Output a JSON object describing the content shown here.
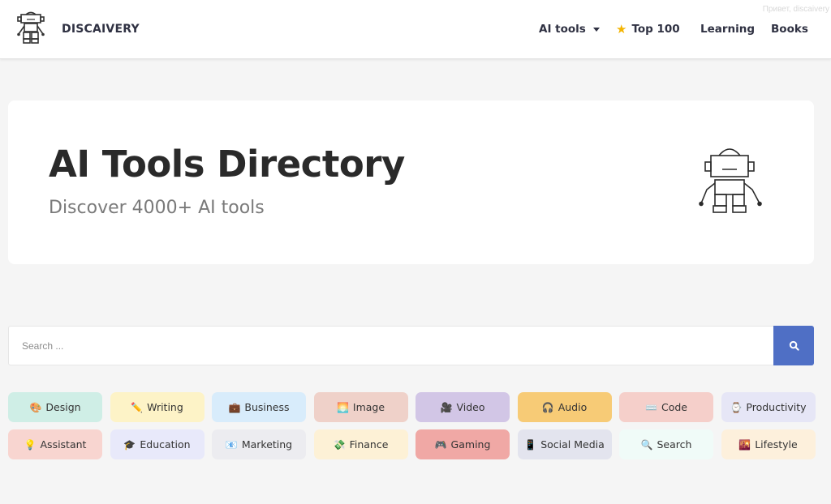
{
  "header": {
    "brand": "DISCAIVERY",
    "top_hint": "Привет, discaivery",
    "nav": {
      "ai_tools": "AI tools",
      "top100": "Top 100",
      "learning": "Learning",
      "books": "Books"
    }
  },
  "hero": {
    "title": "AI Tools Directory",
    "subtitle": "Discover 4000+ AI tools"
  },
  "search": {
    "placeholder": "Search ...",
    "value": ""
  },
  "categories": [
    {
      "label": "Design",
      "emoji": "🎨",
      "color": "#cfeee6"
    },
    {
      "label": "Writing",
      "emoji": "✏️",
      "color": "#fdf3c7"
    },
    {
      "label": "Business",
      "emoji": "💼",
      "color": "#d8ecfb"
    },
    {
      "label": "Image",
      "emoji": "🌅",
      "color": "#efd1c9"
    },
    {
      "label": "Video",
      "emoji": "🎥",
      "color": "#d2c6e6"
    },
    {
      "label": "Audio",
      "emoji": "🎧",
      "color": "#f7cb76"
    },
    {
      "label": "Code",
      "emoji": "⌨️",
      "color": "#f5cfca"
    },
    {
      "label": "Productivity",
      "emoji": "⌚",
      "color": "#e6e6f6"
    },
    {
      "label": "Assistant",
      "emoji": "💡",
      "color": "#f8d5d0"
    },
    {
      "label": "Education",
      "emoji": "🎓",
      "color": "#e8e9fa"
    },
    {
      "label": "Marketing",
      "emoji": "📧",
      "color": "#ececf0"
    },
    {
      "label": "Finance",
      "emoji": "💸",
      "color": "#fdf1d6"
    },
    {
      "label": "Gaming",
      "emoji": "🎮",
      "color": "#f0a8a5"
    },
    {
      "label": "Social Media",
      "emoji": "📱",
      "color": "#e3e4ee"
    },
    {
      "label": "Search",
      "emoji": "🔍",
      "color": "#f0fbf8"
    },
    {
      "label": "Lifestyle",
      "emoji": "🌇",
      "color": "#fdf0dc"
    }
  ],
  "colors": {
    "accent": "#4f6fc5",
    "background": "#f5f5f5",
    "text": "#2f3142"
  }
}
